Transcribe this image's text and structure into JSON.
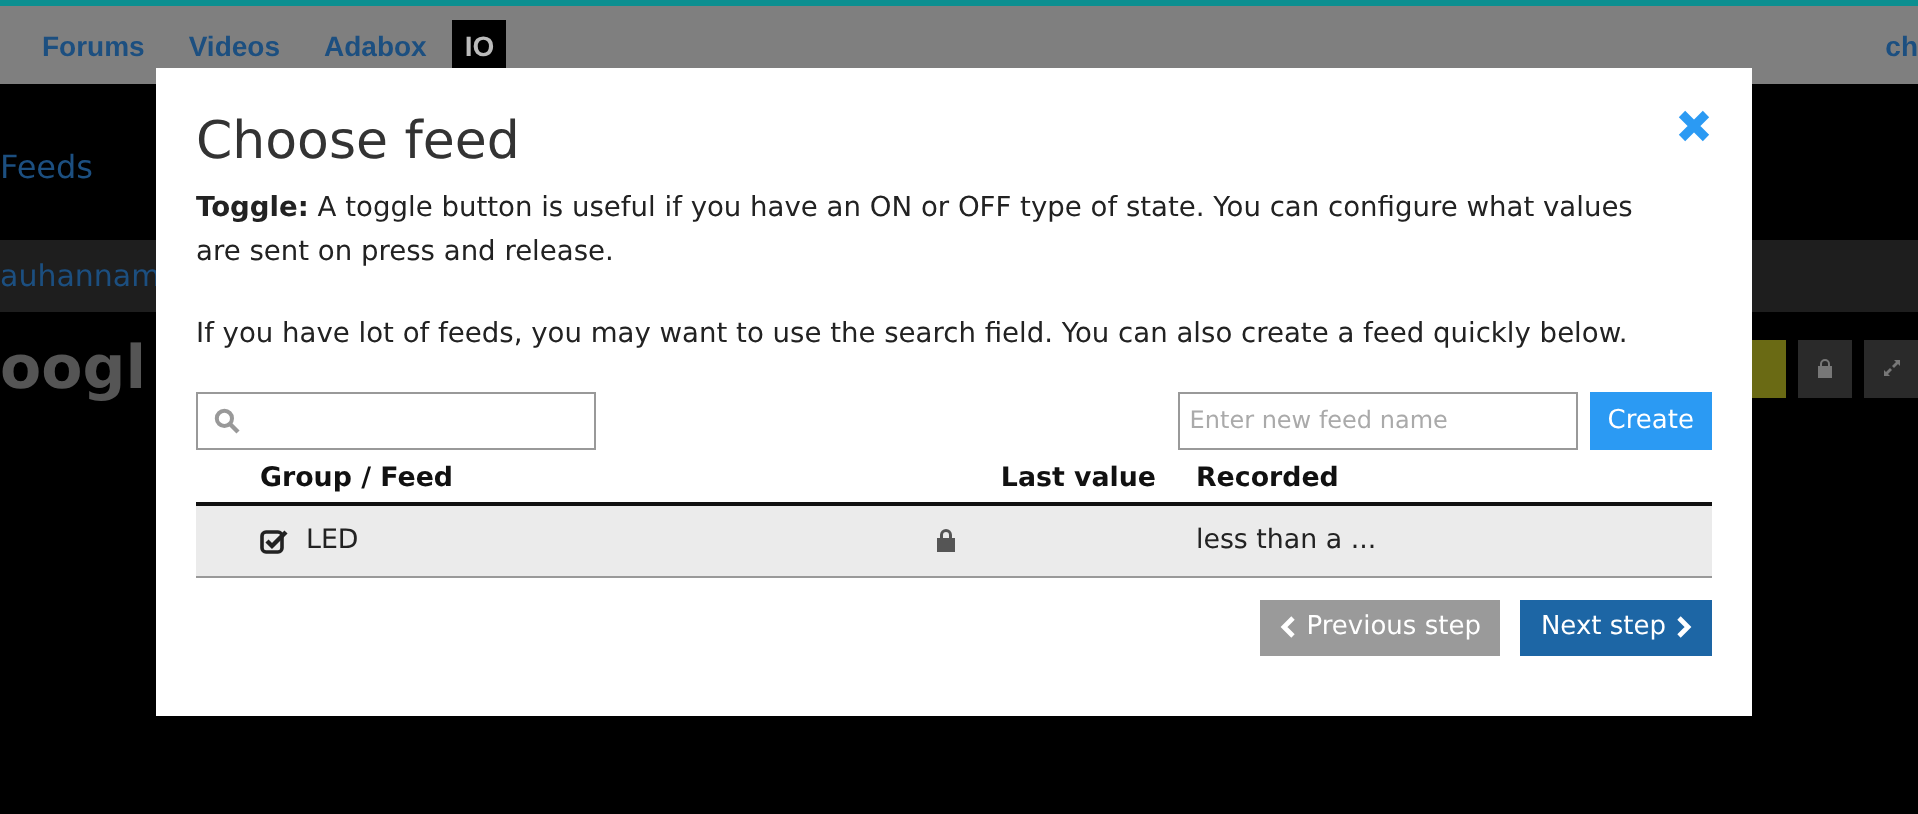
{
  "nav": {
    "items": [
      {
        "label": "Forums",
        "selected": false
      },
      {
        "label": "Videos",
        "selected": false
      },
      {
        "label": "Adabox",
        "selected": false
      },
      {
        "label": "IO",
        "selected": true
      }
    ],
    "user": "ch"
  },
  "page": {
    "breadcrumb": "Feeds",
    "owner": "auhannam",
    "title": "oogl"
  },
  "modal": {
    "title": "Choose feed",
    "intro_label": "Toggle:",
    "intro": "A toggle button is useful if you have an ON or OFF type of state. You can configure what values are sent on press and release.",
    "hint": "If you have lot of feeds, you may want to use the search field. You can also create a feed quickly below.",
    "new_feed": {
      "placeholder": "Enter new feed name"
    },
    "create": "Create",
    "columns": [
      "Group / Feed",
      "Last value",
      "Recorded"
    ],
    "rows": [
      {
        "name": "LED",
        "checked": true,
        "locked": true,
        "recorded": "less than a ..."
      }
    ],
    "previous": "Previous step",
    "next": "Next step"
  }
}
